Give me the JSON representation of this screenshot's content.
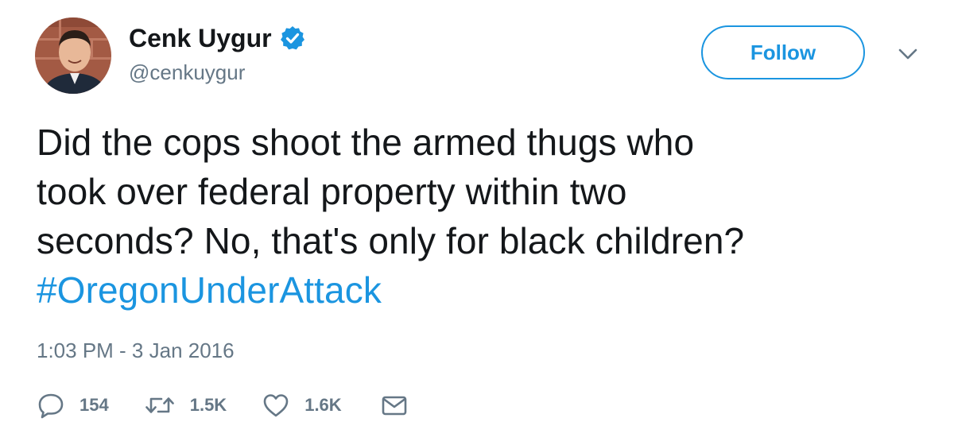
{
  "user": {
    "display_name": "Cenk Uygur",
    "handle": "@cenkuygur",
    "avatar_icon": "profile-photo",
    "verified_icon": "verified-badge-icon"
  },
  "follow_button": {
    "label": "Follow"
  },
  "menu_icon": "chevron-down-icon",
  "tweet": {
    "text_lines": [
      "Did the cops shoot the armed thugs who",
      "took over federal property within two",
      "seconds? No, that's only for black children?"
    ],
    "hashtag": "#OregonUnderAttack",
    "timestamp": "1:03 PM - 3 Jan 2016"
  },
  "actions": {
    "reply": {
      "icon": "reply-icon",
      "count": "154"
    },
    "retweet": {
      "icon": "retweet-icon",
      "count": "1.5K"
    },
    "like": {
      "icon": "heart-icon",
      "count": "1.6K"
    },
    "message": {
      "icon": "envelope-icon"
    }
  },
  "colors": {
    "accent": "#1b95e0",
    "text": "#14171a",
    "muted": "#657786"
  }
}
